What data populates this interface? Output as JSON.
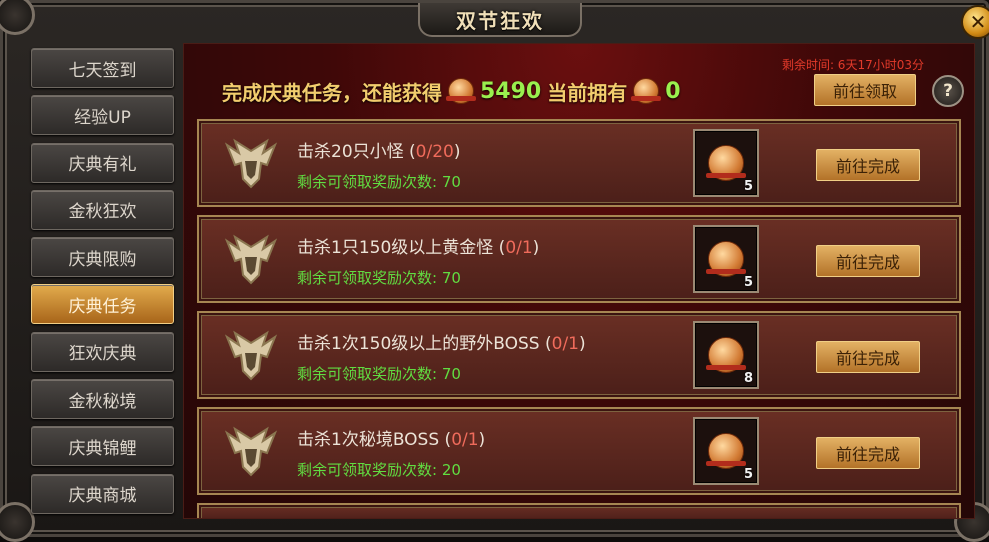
{
  "window": {
    "title": "双节狂欢",
    "close_label": "✕"
  },
  "sidebar": {
    "items": [
      {
        "label": "七天签到",
        "active": false
      },
      {
        "label": "经验UP",
        "active": false
      },
      {
        "label": "庆典有礼",
        "active": false
      },
      {
        "label": "金秋狂欢",
        "active": false
      },
      {
        "label": "庆典限购",
        "active": false
      },
      {
        "label": "庆典任务",
        "active": true
      },
      {
        "label": "狂欢庆典",
        "active": false
      },
      {
        "label": "金秋秘境",
        "active": false
      },
      {
        "label": "庆典锦鲤",
        "active": false
      },
      {
        "label": "庆典商城",
        "active": false
      }
    ]
  },
  "header": {
    "text_before": "完成庆典任务，还能获得",
    "obtainable": "5490",
    "text_middle": "当前拥有",
    "owned": "0",
    "timer": "剩余时间: 6天17小时03分",
    "claim_label": "前往领取",
    "help_label": "?",
    "coin_icon": "festival-coin-icon"
  },
  "tasks": [
    {
      "title": "击杀20只小怪 (",
      "progress": "0/20",
      "close": ")",
      "remain": "剩余可领取奖励次数: 70",
      "reward_count": "5",
      "button": "前往完成"
    },
    {
      "title": "击杀1只150级以上黄金怪 (",
      "progress": "0/1",
      "close": ")",
      "remain": "剩余可领取奖励次数: 70",
      "reward_count": "5",
      "button": "前往完成"
    },
    {
      "title": "击杀1次150级以上的野外BOSS (",
      "progress": "0/1",
      "close": ")",
      "remain": "剩余可领取奖励次数: 70",
      "reward_count": "8",
      "button": "前往完成"
    },
    {
      "title": "击杀1次秘境BOSS (",
      "progress": "0/1",
      "close": ")",
      "remain": "剩余可领取奖励次数: 20",
      "reward_count": "5",
      "button": "前往完成"
    }
  ],
  "colors": {
    "accent_gold": "#e3b164",
    "progress_red": "#ef6b5b",
    "remain_green": "#61dd41",
    "highlight_green": "#9af04e"
  }
}
